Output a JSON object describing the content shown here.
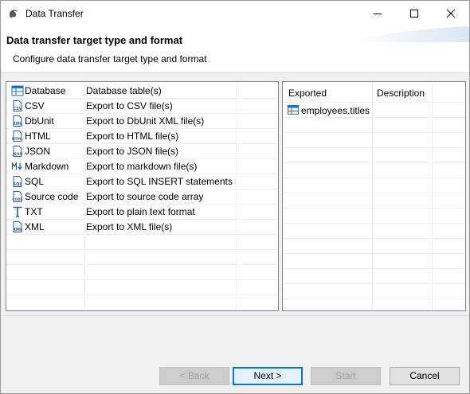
{
  "window": {
    "title": "Data Transfer"
  },
  "header": {
    "title": "Data transfer target type and format",
    "description": "Configure data transfer target type and format"
  },
  "formats": [
    {
      "icon": "database-table-icon",
      "name": "Database",
      "description": "Database table(s)"
    },
    {
      "icon": "csv-file-icon",
      "name": "CSV",
      "description": "Export to CSV file(s)"
    },
    {
      "icon": "xml-file-icon",
      "name": "DbUnit",
      "description": "Export to DbUnit XML file(s)"
    },
    {
      "icon": "html-file-icon",
      "name": "HTML",
      "description": "Export to HTML file(s)"
    },
    {
      "icon": "json-file-icon",
      "name": "JSON",
      "description": "Export to JSON file(s)"
    },
    {
      "icon": "markdown-icon",
      "name": "Markdown",
      "description": "Export to markdown file(s)"
    },
    {
      "icon": "sql-file-icon",
      "name": "SQL",
      "description": "Export to SQL INSERT statements"
    },
    {
      "icon": "code-file-icon",
      "name": "Source code",
      "description": "Export to source code array"
    },
    {
      "icon": "text-icon",
      "name": "TXT",
      "description": "Export to plain text format"
    },
    {
      "icon": "xml-file-icon",
      "name": "XML",
      "description": "Export to XML file(s)"
    }
  ],
  "exported_table": {
    "columns": [
      "Exported",
      "Description"
    ],
    "rows": [
      {
        "icon": "table-icon",
        "name": "employees.titles",
        "description": ""
      }
    ]
  },
  "buttons": {
    "back": "< Back",
    "next": "Next >",
    "start": "Start",
    "cancel": "Cancel"
  },
  "colors": {
    "accent": "#0078d7",
    "table_icon": "#1e6fc8",
    "file_icon": "#2a5fa8"
  }
}
